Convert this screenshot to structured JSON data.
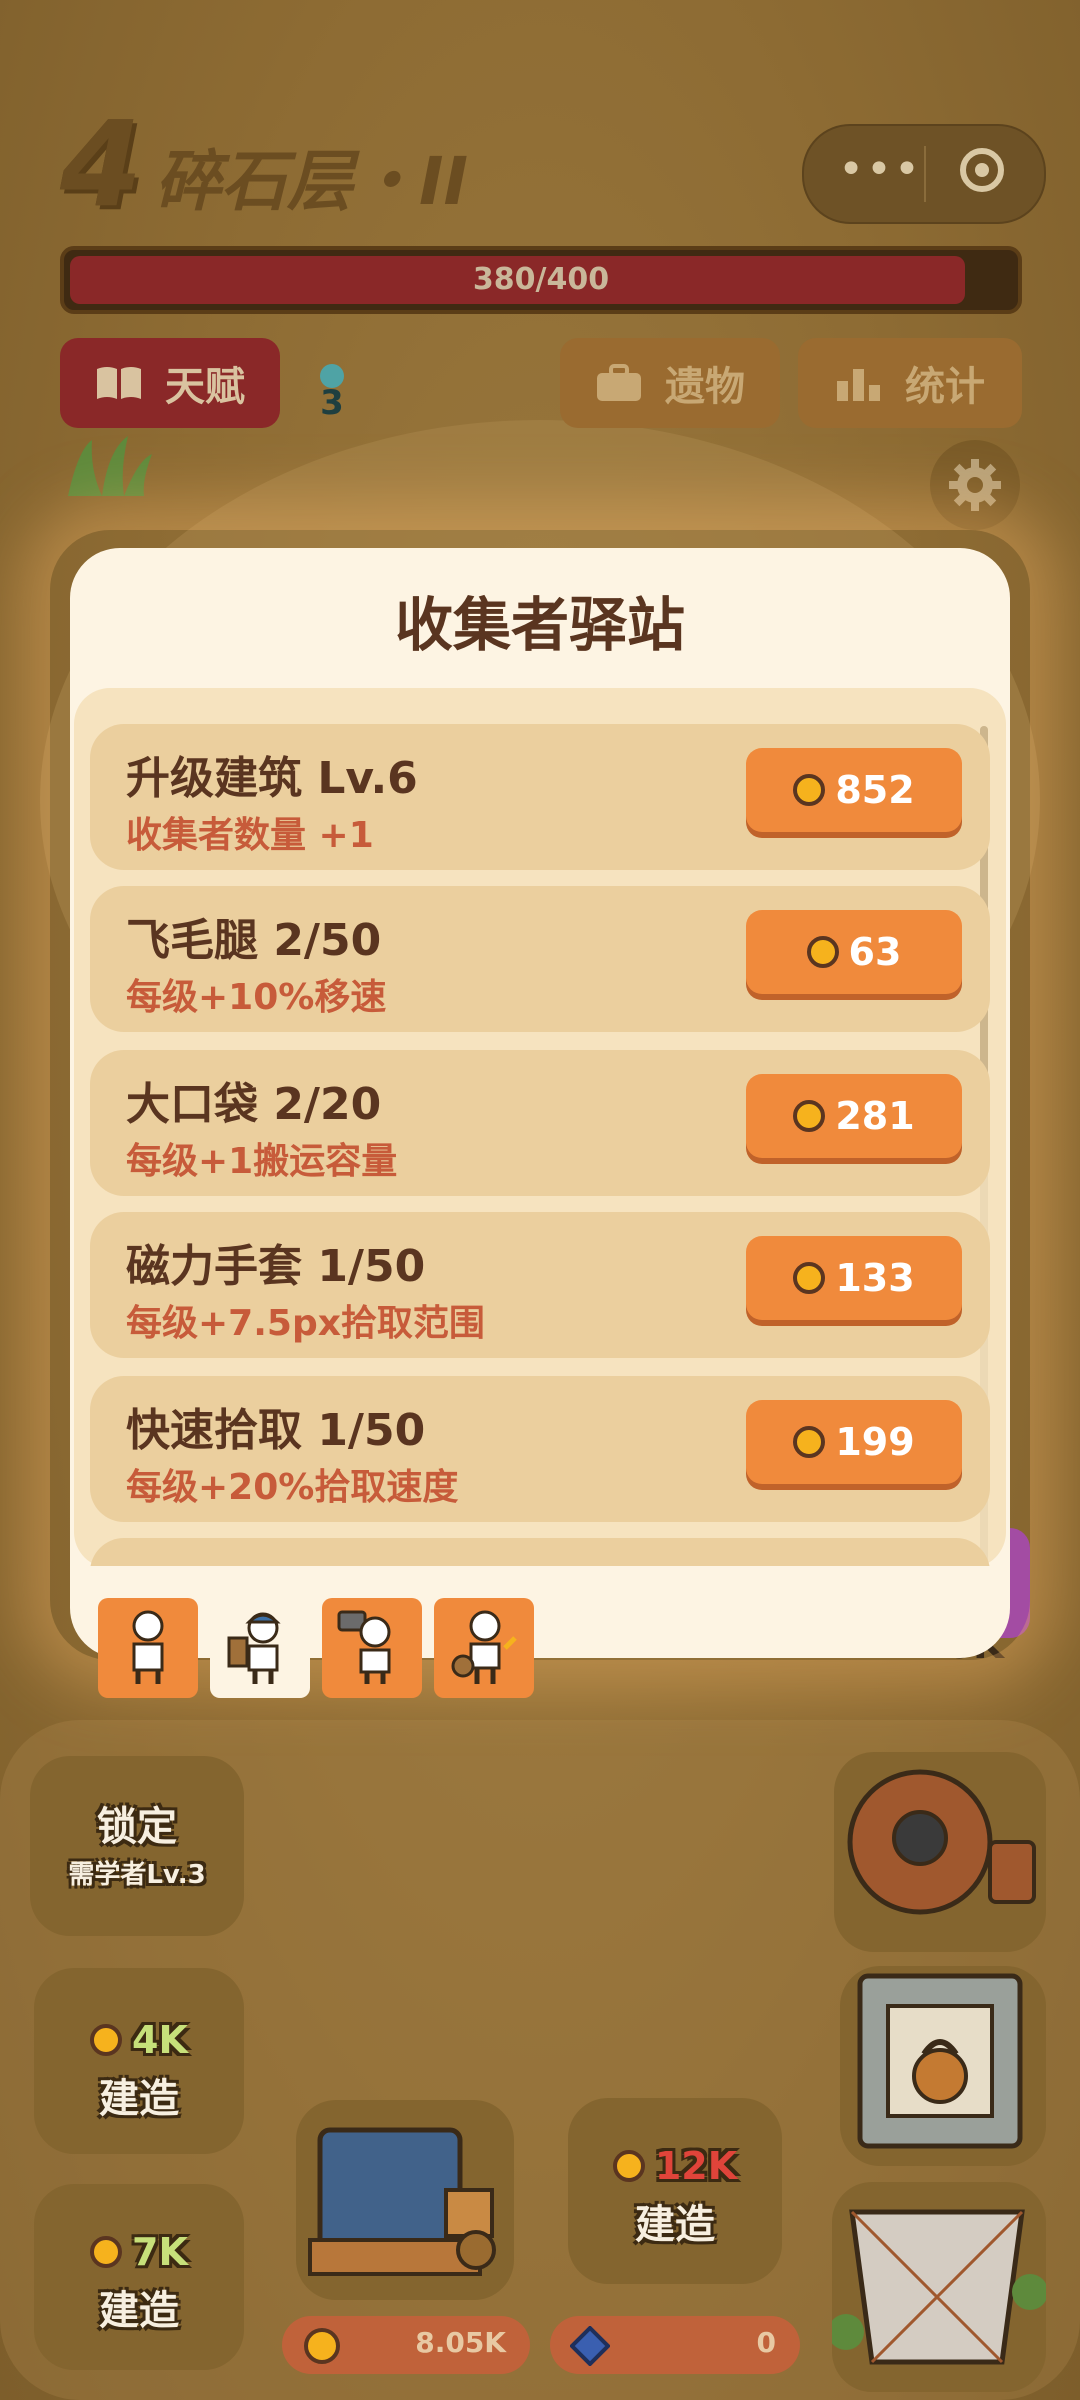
{
  "level": {
    "number": "4",
    "name": "碎石层・II"
  },
  "hp": {
    "text": "380/400",
    "fraction": 0.95
  },
  "top_buttons": {
    "talent": "天赋",
    "talent_badge": "3",
    "relics": "遗物",
    "stats": "统计"
  },
  "modal": {
    "title": "收集者驿站",
    "items": [
      {
        "title": "升级建筑 Lv.6",
        "desc": "收集者数量 +1",
        "price": "852"
      },
      {
        "title": "飞毛腿 2/50",
        "desc": "每级+10%移速",
        "price": "63"
      },
      {
        "title": "大口袋 2/20",
        "desc": "每级+1搬运容量",
        "price": "281"
      },
      {
        "title": "磁力手套 1/50",
        "desc": "每级+7.5px拾取范围",
        "price": "133"
      },
      {
        "title": "快速拾取 1/50",
        "desc": "每级+20%拾取速度",
        "price": "199"
      }
    ],
    "character_tabs": [
      "basic-collector",
      "porter-collector",
      "miner-collector",
      "gatherer-collector"
    ],
    "selected_tab": 1
  },
  "scene": {
    "side_value": "2.6K",
    "locked_slot": {
      "title": "锁定",
      "sub": "需学者Lv.3"
    },
    "build_slots": [
      {
        "cost": "4K",
        "label": "建造"
      },
      {
        "cost": "7K",
        "label": "建造"
      },
      {
        "cost": "12K",
        "label": "建造"
      }
    ],
    "resources": {
      "gold": "8.05K",
      "gem": "0"
    }
  },
  "colors": {
    "accent": "#f08a3c",
    "danger": "#8a2828",
    "panel": "#fdf4e3"
  }
}
